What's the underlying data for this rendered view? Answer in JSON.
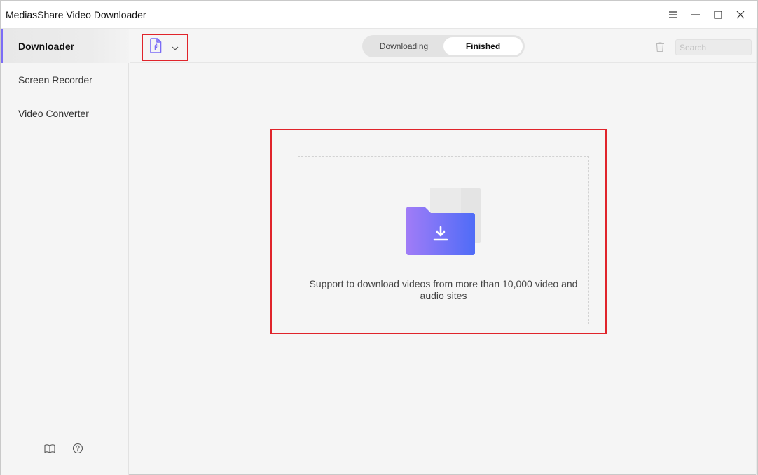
{
  "window": {
    "title": "MediasShare Video Downloader",
    "controls": [
      {
        "name": "menu-icon",
        "label": "menu"
      },
      {
        "name": "minimize-icon",
        "label": "minimize"
      },
      {
        "name": "maximize-icon",
        "label": "maximize"
      },
      {
        "name": "close-icon",
        "label": "close"
      }
    ]
  },
  "sidebar": {
    "items": [
      {
        "label": "Downloader",
        "active": true
      },
      {
        "label": "Screen Recorder",
        "active": false
      },
      {
        "label": "Video Converter",
        "active": false
      }
    ],
    "footer_icons": [
      "book-icon",
      "help-icon"
    ]
  },
  "toolbar": {
    "paste_icon": "paste-url-icon",
    "dropdown_icon": "chevron-down-icon",
    "tabs": [
      {
        "label": "Downloading",
        "active": false
      },
      {
        "label": "Finished",
        "active": true
      }
    ],
    "trash_icon": "trash-icon",
    "search": {
      "placeholder": "Search",
      "value": ""
    }
  },
  "main": {
    "dropzone_icon": "download-folder-icon",
    "dropzone_text": "Support to download videos from more than 10,000 video and audio sites"
  },
  "colors": {
    "accent": "#7b6cf6",
    "highlight": "#e0242b",
    "folder_start": "#a07cf7",
    "folder_end": "#4f6cf7"
  }
}
